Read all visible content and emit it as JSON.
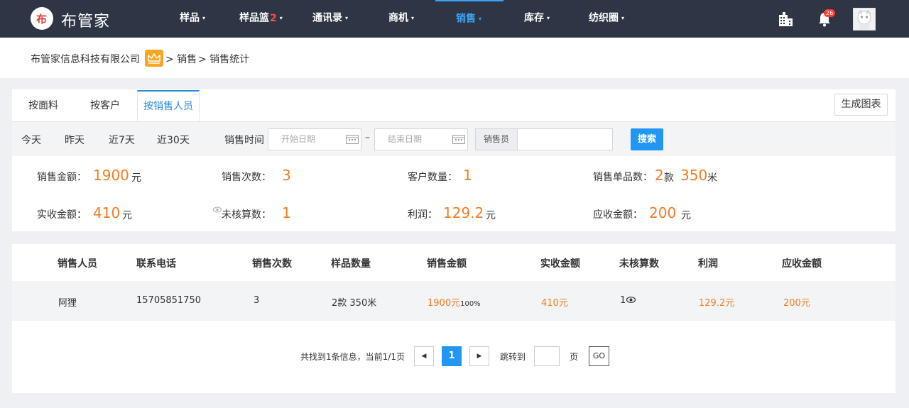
{
  "brand": {
    "logo_glyph": "布",
    "name": "布管家"
  },
  "nav": {
    "items": [
      {
        "label": "样品",
        "badge": "",
        "caret": "▾"
      },
      {
        "label": "样品篮",
        "badge": "2",
        "caret": "▾"
      },
      {
        "label": "通讯录",
        "badge": "",
        "caret": "▾"
      },
      {
        "label": "商机",
        "badge": "",
        "caret": "▾"
      },
      {
        "label": "销售",
        "badge": "",
        "caret": "▾",
        "active": true
      },
      {
        "label": "库存",
        "badge": "",
        "caret": "▾"
      },
      {
        "label": "纺织圈",
        "badge": "",
        "caret": "▾"
      }
    ],
    "notification_count": "26",
    "icons": [
      "building-icon",
      "bell-icon",
      "avatar"
    ]
  },
  "breadcrumb": {
    "company": "布管家信息科技有限公司",
    "level1": "> 销售",
    "level2": "> 销售统计",
    "badge_icon": "crown-icon"
  },
  "tabs": [
    {
      "label": "按面料"
    },
    {
      "label": "按客户"
    },
    {
      "label": "按销售人员",
      "active": true
    }
  ],
  "actions": {
    "chart_button": "生成图表"
  },
  "filters": {
    "quick_ranges": [
      "今天",
      "昨天",
      "近7天",
      "近30天"
    ],
    "time_label": "销售时间",
    "start_placeholder": "开始日期",
    "end_placeholder": "结束日期",
    "range_separator": "–",
    "seller_label": "销售员",
    "seller_value": "",
    "search_button": "搜索"
  },
  "stats": {
    "sales_amount": {
      "label": "销售金额：",
      "value": "1900",
      "unit": "元"
    },
    "sales_count": {
      "label": "销售次数：",
      "value": "3"
    },
    "customer_count": {
      "label": "客户数量：",
      "value": "1"
    },
    "item_count": {
      "label": "销售单品数：",
      "value": "2",
      "unit1": "款",
      "value2": "350",
      "unit2": "米"
    },
    "received": {
      "label": "实收金额：",
      "value": "410",
      "unit": "元"
    },
    "unchecked": {
      "label": "未核算数：",
      "value": "1"
    },
    "profit": {
      "label": "利润：",
      "value": "129.2",
      "unit": "元"
    },
    "receivable": {
      "label": "应收金额：",
      "value": "200",
      "unit": "元"
    }
  },
  "table": {
    "columns": [
      "销售人员",
      "联系电话",
      "销售次数",
      "样品数量",
      "销售金额",
      "实收金额",
      "未核算数",
      "利润",
      "应收金额"
    ],
    "rows": [
      {
        "name": "阿狸",
        "phone": "15705851750",
        "count": "3",
        "samples": "2款 350米",
        "amount": "1900元",
        "amount_pct": "100%",
        "received": "410元",
        "unchecked": "1",
        "profit": "129.2元",
        "receivable": "200元"
      }
    ]
  },
  "pager": {
    "summary": "共找到1条信息，当前1/1页",
    "prev": "◀",
    "current": "1",
    "next": "▶",
    "jump_label": "跳转到",
    "page_suffix": "页",
    "go": "GO"
  },
  "colors": {
    "nav_bg": "#2e3544",
    "accent": "#2196f3",
    "value_orange": "#f47c20"
  }
}
